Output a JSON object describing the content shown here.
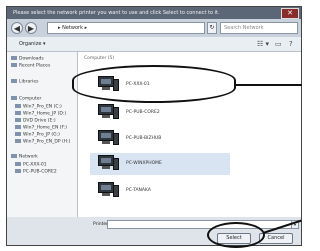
{
  "window": {
    "title": "Please select the network printer you want to use and click Select to connect to it.",
    "close_glyph": "✕"
  },
  "address": {
    "back_glyph": "◀",
    "forward_glyph": "▶",
    "path": "▸ Network ▸",
    "refresh_glyph": "↻",
    "search_placeholder": "Search Network"
  },
  "toolbar": {
    "organize_label": "Organize ▾",
    "views_glyph": "☷ ▾",
    "pane_glyph": "▭",
    "help_glyph": "?"
  },
  "nav": {
    "items": [
      {
        "label": "Downloads"
      },
      {
        "label": "Recent Places"
      },
      {
        "label": "Libraries"
      },
      {
        "label": "Computer"
      },
      {
        "label": "Win7_Pro_EN (C:)"
      },
      {
        "label": "Win7_Home_JP (D:)"
      },
      {
        "label": "DVD Drive (E:)"
      },
      {
        "label": "Win7_Home_EN (F:)"
      },
      {
        "label": "Win7_Pro_JP (G:)"
      },
      {
        "label": "Win7_Pro_EN_DP (H:)"
      },
      {
        "label": "Network"
      },
      {
        "label": "PC-XXX-01"
      },
      {
        "label": "PC-PUB-CORE2"
      }
    ]
  },
  "main": {
    "header": "Computer (5)",
    "items": [
      {
        "label": "PC-XXX-01"
      },
      {
        "label": "PC-PUB-CORE2"
      },
      {
        "label": "PC-PUB-BIZHUB"
      },
      {
        "label": "PC-WINXPHOME"
      },
      {
        "label": "PC-TANAKA"
      }
    ]
  },
  "bottom": {
    "filename_label": "Printer:",
    "filename_value": "",
    "dropdown_glyph": "▾",
    "select_label": "Select",
    "cancel_label": "Cancel"
  }
}
